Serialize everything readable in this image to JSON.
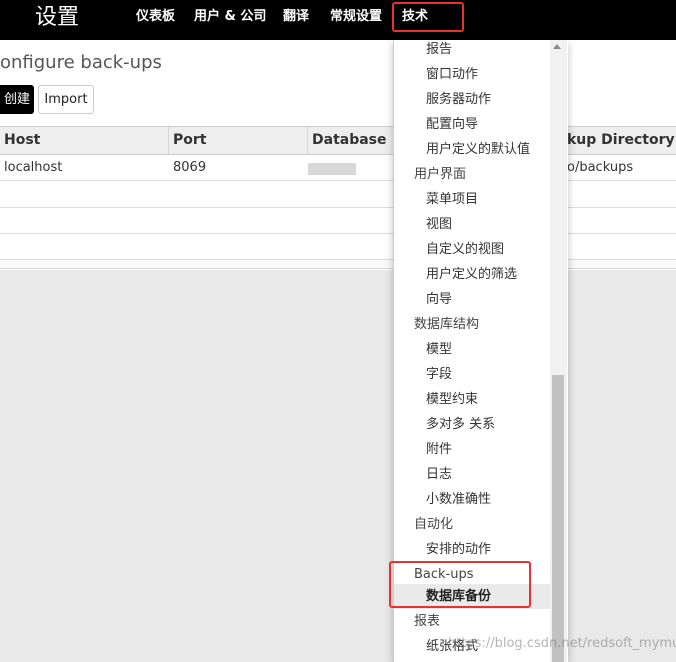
{
  "topbar": {
    "app_title": "设置",
    "nav": [
      {
        "label": "仪表板"
      },
      {
        "label": "用户 & 公司"
      },
      {
        "label": "翻译"
      },
      {
        "label": "常规设置"
      },
      {
        "label": "技术"
      }
    ]
  },
  "page": {
    "title": "onfigure back-ups",
    "create_label": "创建",
    "import_label": "Import"
  },
  "table": {
    "headers": [
      "Host",
      "Port",
      "Database",
      "kup Directory"
    ],
    "rows": [
      {
        "host": "localhost",
        "port": "8069",
        "database": "",
        "directory": "o/backups"
      }
    ]
  },
  "menu": {
    "items": [
      {
        "label": "报告",
        "type": "leaf"
      },
      {
        "label": "窗口动作",
        "type": "leaf"
      },
      {
        "label": "服务器动作",
        "type": "leaf"
      },
      {
        "label": "配置向导",
        "type": "leaf"
      },
      {
        "label": "用户定义的默认值",
        "type": "leaf"
      },
      {
        "label": "用户界面",
        "type": "header"
      },
      {
        "label": "菜单项目",
        "type": "leaf"
      },
      {
        "label": "视图",
        "type": "leaf"
      },
      {
        "label": "自定义的视图",
        "type": "leaf"
      },
      {
        "label": "用户定义的筛选",
        "type": "leaf"
      },
      {
        "label": "向导",
        "type": "leaf"
      },
      {
        "label": "数据库结构",
        "type": "header"
      },
      {
        "label": "模型",
        "type": "leaf"
      },
      {
        "label": "字段",
        "type": "leaf"
      },
      {
        "label": "模型约束",
        "type": "leaf"
      },
      {
        "label": "多对多 关系",
        "type": "leaf"
      },
      {
        "label": "附件",
        "type": "leaf"
      },
      {
        "label": "日志",
        "type": "leaf"
      },
      {
        "label": "小数准确性",
        "type": "leaf"
      },
      {
        "label": "自动化",
        "type": "header"
      },
      {
        "label": "安排的动作",
        "type": "leaf"
      },
      {
        "label": "Back-ups",
        "type": "header"
      },
      {
        "label": "数据库备份",
        "type": "leaf",
        "active": true
      },
      {
        "label": "报表",
        "type": "header"
      },
      {
        "label": "纸张格式",
        "type": "leaf"
      }
    ]
  },
  "watermark": "https://blog.csdn.net/redsoft_mymuch",
  "colors": {
    "topbar_bg": "#000000",
    "highlight_border": "#e8322f",
    "active_item_bg": "#eaeaea"
  }
}
